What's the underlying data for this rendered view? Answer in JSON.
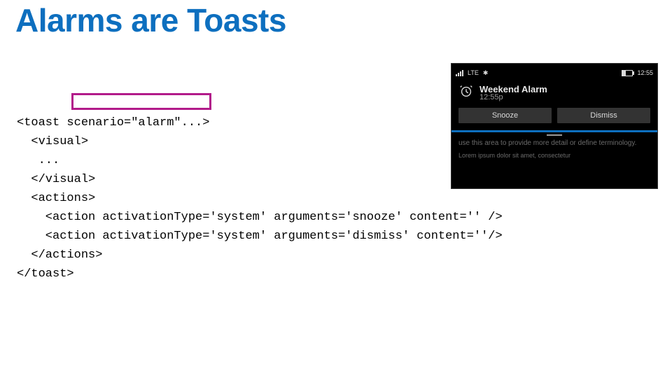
{
  "title": "Alarms are Toasts",
  "code": {
    "l1": "<toast scenario=\"alarm\"...>",
    "l2": "  <visual>",
    "l3": "   ...",
    "l4": "  </visual>",
    "l5": "  <actions>",
    "l6": "    <action activationType='system' arguments='snooze' content='' />",
    "l7": "    <action activationType='system' arguments='dismiss' content=''/>",
    "l8": "  </actions>",
    "l9": "</toast>"
  },
  "phone": {
    "status": {
      "lte": "LTE",
      "bt": "✱",
      "time": "12:55"
    },
    "toast": {
      "title": "Weekend Alarm",
      "subtitle": "12:55p",
      "snooze": "Snooze",
      "dismiss": "Dismiss"
    },
    "hint": "use this area to provide more detail or define terminology.",
    "lorem": "Lorem ipsum dolor sit amet, consectetur"
  }
}
